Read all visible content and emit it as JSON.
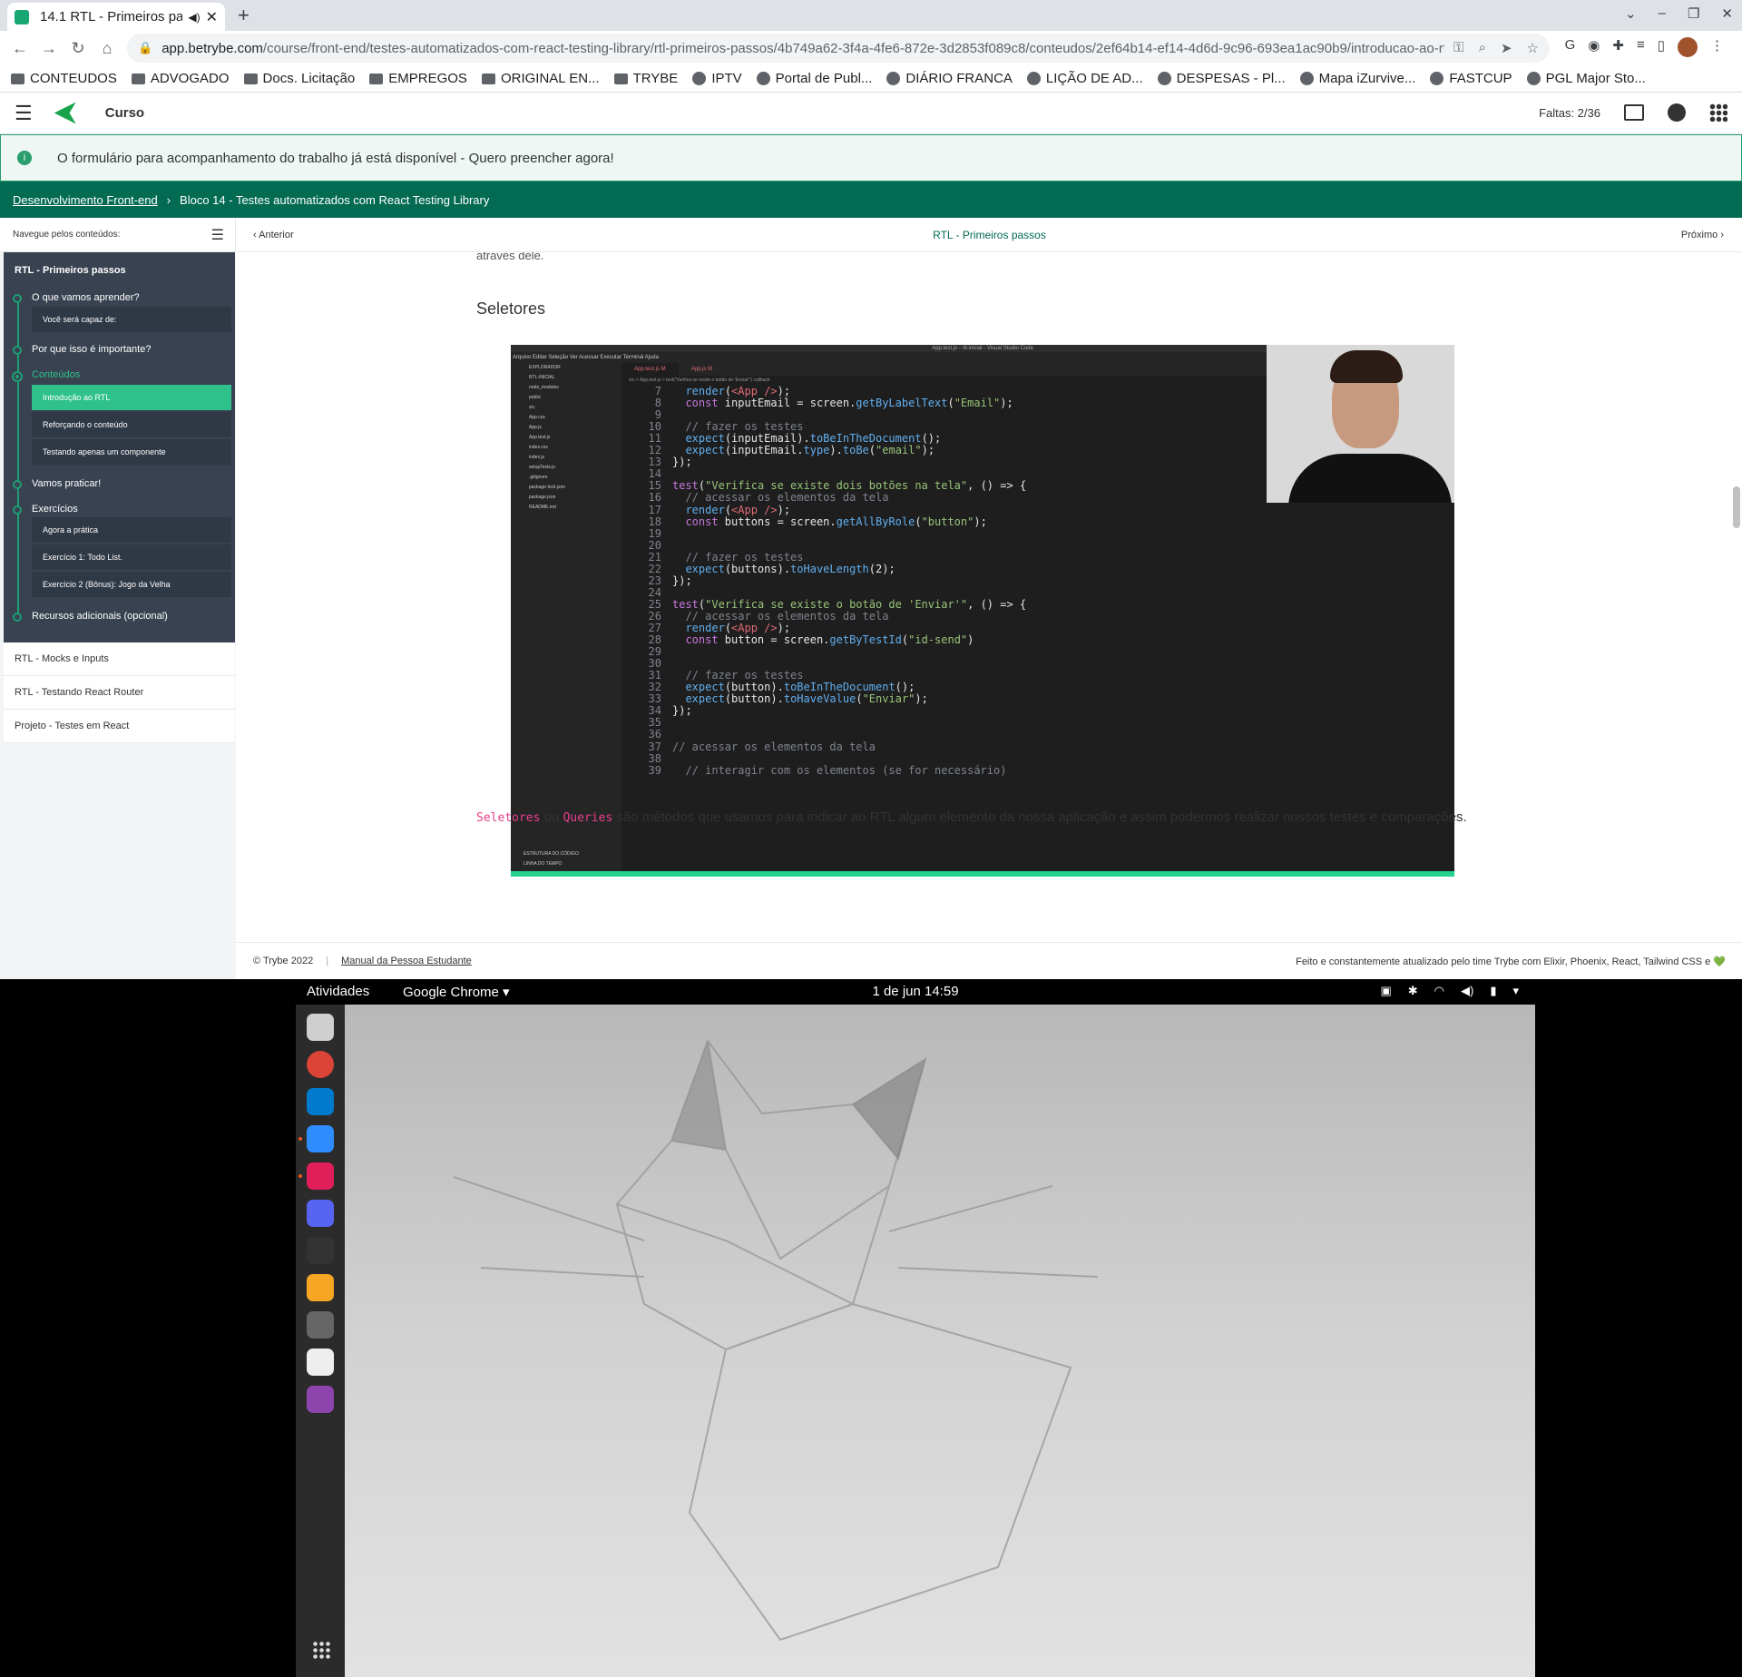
{
  "browser": {
    "tab_title": "14.1 RTL - Primeiros pa",
    "tab_audio_icon": "speaker-icon",
    "url_host": "app.betrybe.com",
    "url_path": "/course/front-end/testes-automatizados-com-react-testing-library/rtl-primeiros-passos/4b749a62-3f4a-4fe6-872e-3d2853f089c8/conteudos/2ef64b14-ef14-4d6d-9c96-693ea1ac90b9/introducao-ao-rtl...",
    "bookmarks": [
      "CONTEUDOS",
      "ADVOGADO",
      "Docs. Licitação",
      "EMPREGOS",
      "ORIGINAL EN...",
      "TRYBE",
      "IPTV",
      "Portal de Publ...",
      "DIÁRIO FRANCA",
      "LIÇÃO DE AD...",
      "DESPESAS - Pl...",
      "Mapa iZurvive...",
      "FASTCUP",
      "PGL Major Sto..."
    ]
  },
  "app": {
    "title": "Curso",
    "faltas": "Faltas: 2/36",
    "banner": "O formulário para acompanhamento do trabalho já está disponível - Quero preencher agora!",
    "breadcrumb": {
      "root": "Desenvolvimento Front-end",
      "current": "Bloco 14 - Testes automatizados com React Testing Library"
    }
  },
  "sidebar": {
    "heading": "Navegue pelos conteúdos:",
    "module_title": "RTL - Primeiros passos",
    "sections": [
      {
        "label": "O que vamos aprender?",
        "subs": [
          "Você será capaz de:"
        ]
      },
      {
        "label": "Por que isso é importante?",
        "subs": []
      },
      {
        "label": "Conteúdos",
        "subs": [
          "Introdução ao RTL",
          "Reforçando o conteúdo",
          "Testando apenas um componente"
        ]
      },
      {
        "label": "Vamos praticar!",
        "subs": []
      },
      {
        "label": "Exercícios",
        "subs": [
          "Agora a prática",
          "Exercício 1: Todo List.",
          "Exercício 2 (Bônus): Jogo da Velha"
        ]
      },
      {
        "label": "Recursos adicionais (opcional)",
        "subs": []
      }
    ],
    "modules": [
      "RTL - Mocks e Inputs",
      "RTL - Testando React Router",
      "Projeto - Testes em React"
    ]
  },
  "content": {
    "prev": "Anterior",
    "title": "RTL - Primeiros passos",
    "next": "Próximo",
    "cut_text": "através dele.",
    "heading": "Seletores",
    "paragraph": {
      "code1": "Seletores",
      "mid": " ou ",
      "code2": "Queries",
      "rest": " são métodos que usamos para indicar ao RTL algum elemento da nossa aplicação e assim podermos realizar nossos testes e comparações."
    }
  },
  "video": {
    "window_title": "App.test.js - rtl-inicial - Visual Studio Code",
    "menu": "Arquivo  Editar  Seleção  Ver  Acessar  Executar  Terminal  Ajuda",
    "tabs": [
      "App.test.js M",
      "App.js M"
    ],
    "crumb": "src > App.test.js > test(\"Verifica se existe o botão de 'Enviar'\") callback",
    "explorer": [
      "EXPLORADOR",
      "RTL-INICIAL",
      "node_modules",
      "public",
      "src",
      "App.css",
      "App.js",
      "App.test.js",
      "index.css",
      "index.js",
      "setupTests.js",
      ".gitignore",
      "package-lock.json",
      "package.json",
      "README.md",
      "ESTRUTURA DO CÓDIGO",
      "LINHA DO TEMPO"
    ],
    "code_lines": [
      {
        "n": "7",
        "t": "  render(<App />);"
      },
      {
        "n": "8",
        "t": "  const inputEmail = screen.getByLabelText(\"Email\");"
      },
      {
        "n": "9",
        "t": ""
      },
      {
        "n": "10",
        "t": "  // fazer os testes"
      },
      {
        "n": "11",
        "t": "  expect(inputEmail).toBeInTheDocument();"
      },
      {
        "n": "12",
        "t": "  expect(inputEmail.type).toBe(\"email\");"
      },
      {
        "n": "13",
        "t": "});"
      },
      {
        "n": "14",
        "t": ""
      },
      {
        "n": "15",
        "t": "test(\"Verifica se existe dois botões na tela\", () => {"
      },
      {
        "n": "16",
        "t": "  // acessar os elementos da tela"
      },
      {
        "n": "17",
        "t": "  render(<App />);"
      },
      {
        "n": "18",
        "t": "  const buttons = screen.getAllByRole(\"button\");"
      },
      {
        "n": "19",
        "t": ""
      },
      {
        "n": "20",
        "t": ""
      },
      {
        "n": "21",
        "t": "  // fazer os testes"
      },
      {
        "n": "22",
        "t": "  expect(buttons).toHaveLength(2);"
      },
      {
        "n": "23",
        "t": "});"
      },
      {
        "n": "24",
        "t": ""
      },
      {
        "n": "25",
        "t": "test(\"Verifica se existe o botão de 'Enviar'\", () => {"
      },
      {
        "n": "26",
        "t": "  // acessar os elementos da tela"
      },
      {
        "n": "27",
        "t": "  render(<App />);"
      },
      {
        "n": "28",
        "t": "  const button = screen.getByTestId(\"id-send\")"
      },
      {
        "n": "29",
        "t": ""
      },
      {
        "n": "30",
        "t": ""
      },
      {
        "n": "31",
        "t": "  // fazer os testes"
      },
      {
        "n": "32",
        "t": "  expect(button).toBeInTheDocument();"
      },
      {
        "n": "33",
        "t": "  expect(button).toHaveValue(\"Enviar\");"
      },
      {
        "n": "34",
        "t": "});"
      },
      {
        "n": "35",
        "t": ""
      },
      {
        "n": "36",
        "t": ""
      },
      {
        "n": "37",
        "t": "// acessar os elementos da tela"
      },
      {
        "n": "38",
        "t": ""
      },
      {
        "n": "39",
        "t": "  // interagir com os elementos (se for necessário)"
      }
    ]
  },
  "footer": {
    "copy": "© Trybe 2022",
    "manual": "Manual da Pessoa Estudante",
    "right": "Feito e constantemente atualizado pelo time Trybe com Elixir, Phoenix, React, Tailwind CSS e 💚"
  },
  "desktop": {
    "activities": "Atividades",
    "app": "Google Chrome ▾",
    "clock": "1 de jun  14:59",
    "dock": [
      "files-icon",
      "chrome-icon",
      "vscode-icon",
      "zoom-icon",
      "slack-icon",
      "discord-icon",
      "terminal-icon",
      "calculator-icon",
      "software-icon",
      "music-icon",
      "feather-icon"
    ]
  },
  "colors": {
    "brand": "#036b52",
    "accent": "#2fc18c",
    "sidebar_dark": "#384250"
  }
}
